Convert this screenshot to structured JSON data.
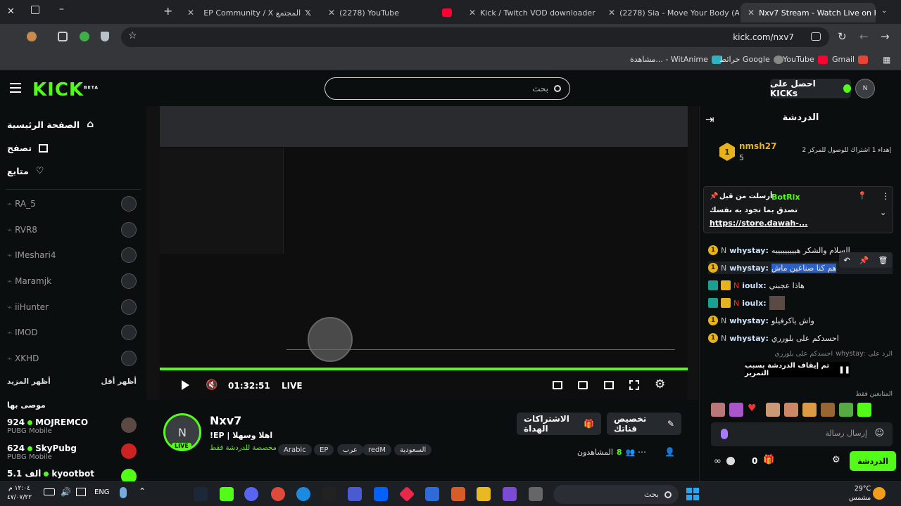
{
  "browser": {
    "tabs": [
      {
        "title": "EP Community / X المجتمع",
        "active": false
      },
      {
        "title": "(2278) YouTube",
        "active": false
      },
      {
        "title": "Kick / Twitch VOD downloader",
        "active": false
      },
      {
        "title": "(2278) Sia - Move Your Body (A",
        "active": false
      },
      {
        "title": "Nxv7 Stream - Watch Live on Ki",
        "active": true
      }
    ],
    "url": "kick.com/nxv7",
    "bookmarks": [
      "Gmail",
      "YouTube",
      "خرائط Google",
      "مشاهدة... - WitAnime"
    ]
  },
  "header": {
    "logo": "KICK",
    "logo_sup": "BETA",
    "search_placeholder": "بحث",
    "kicks_button": "احصل على KICKs"
  },
  "sidebar": {
    "nav": [
      {
        "label": "الصفحة الرئيسية",
        "icon": "home-icon"
      },
      {
        "label": "تصفح",
        "icon": "browse-icon"
      },
      {
        "label": "متابع",
        "icon": "heart-icon"
      }
    ],
    "followed": [
      "RA_5",
      "RVR8",
      "IMeshari4",
      "Maramjk",
      "iiHunter",
      "IMOD",
      "XKHD"
    ],
    "show_more": "أظهر المزيد",
    "show_less": "أظهر أقل",
    "recommended_title": "موصى بها",
    "recommended": [
      {
        "name": "MOJREMCO",
        "game": "PUBG Mobile",
        "viewers": "924"
      },
      {
        "name": "SkyPubg",
        "game": "PUBG Mobile",
        "viewers": "624"
      },
      {
        "name": "kyootbot",
        "game": "",
        "viewers": "5.1 ألف"
      }
    ]
  },
  "player": {
    "time": "01:32:51",
    "live": "LIVE",
    "progress": 1.0
  },
  "stream": {
    "channel": "Nxv7",
    "title": "!EP | اهلا وسهلا",
    "subtitle": "مخصصة للدردشة فقط",
    "live_badge": "LIVE",
    "tags": [
      "السعودية",
      "redM",
      "عرب",
      "EP",
      "Arabic"
    ],
    "viewers_label": "المشاهدون",
    "viewers": "8",
    "customize_button": "تخصيص قناتك",
    "gift_button": "الاشتراكات الهداة"
  },
  "chat": {
    "title": "الدردشة",
    "gifter": {
      "name": "nmsh27",
      "count": "5",
      "rank": "1",
      "note": "إهداء 1 اشتراك للوصول للمركز 2"
    },
    "pinned": {
      "pinned_by": "أرسلت من قبل",
      "user": "BotRix",
      "text": "تصدق بما تجود به نفسك",
      "link": "https://store.dawah-..."
    },
    "messages": [
      {
        "user": "whystay:",
        "text": "السلام والشكر هيييييييييه"
      },
      {
        "user": "whystay:",
        "text": "هم كنا صناعين ماش"
      },
      {
        "user": "ioulx:",
        "text": "هاذا عجبني"
      },
      {
        "user": "ioulx:",
        "text": ""
      },
      {
        "user": "whystay:",
        "text": "واش ياكرفيلو"
      },
      {
        "user": "whystay:",
        "text": "احسدكم على بلورري"
      }
    ],
    "reply_label": "الرد على",
    "reply_user": "whystay:",
    "reply_text": "احسدكم على بلورري",
    "paused": "تم إيقاف الدردشة بسبب التمرير",
    "followers_only": "المتابعين فقط",
    "input_placeholder": "إرسال رسالة",
    "kicks_count": "0",
    "chat_button": "الدردشة"
  },
  "taskbar": {
    "search": "بحث",
    "lang": "ENG",
    "time": "١٢:٠٤ م",
    "date": "٤٧/٠٧/٢٢",
    "temp": "29°C",
    "weather": "مشمس"
  },
  "colors": {
    "accent": "#53fc18",
    "bg": "#0b0e0f",
    "surface": "#26292d"
  }
}
